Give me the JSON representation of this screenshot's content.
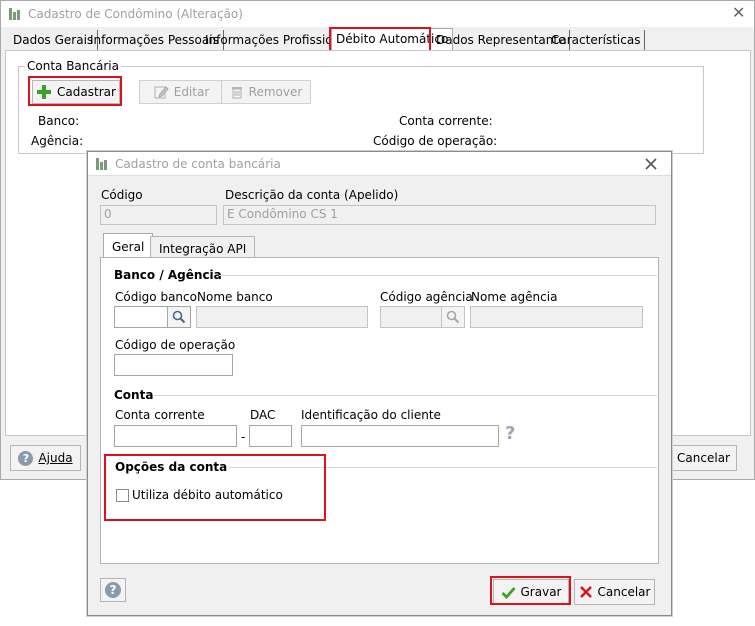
{
  "main_window": {
    "title": "Cadastro de Condômino (Alteração)",
    "tabs": [
      {
        "label": "Dados Gerais"
      },
      {
        "label": "Informações Pessoais"
      },
      {
        "label": "Informações Profissionais"
      },
      {
        "label": "Débito Automático"
      },
      {
        "label": "Dados Representante"
      },
      {
        "label": "Características"
      }
    ],
    "conta_bancaria": {
      "legend": "Conta Bancária",
      "cadastrar_label": "Cadastrar",
      "editar_label": "Editar",
      "remover_label": "Remover",
      "banco_label": "Banco:",
      "agencia_label": "Agência:",
      "conta_corrente_label": "Conta corrente:",
      "codigo_operacao_label": "Código de operação:"
    },
    "ajuda_label": "Ajuda",
    "ajuda_mnemonic": "A",
    "cancelar_label": "Cancelar"
  },
  "dialog": {
    "title": "Cadastro de conta bancária",
    "codigo_label": "Código",
    "codigo_value": "0",
    "descricao_label": "Descrição da conta (Apelido)",
    "descricao_value": "E Condômino CS 1",
    "tabs": [
      {
        "label": "Geral"
      },
      {
        "label": "Integração API"
      }
    ],
    "banco_agencia": {
      "title": "Banco / Agência",
      "codigo_banco_label": "Código banco",
      "codigo_banco_value": "",
      "nome_banco_label": "Nome banco",
      "nome_banco_value": "",
      "codigo_agencia_label": "Código agência",
      "codigo_agencia_value": "",
      "nome_agencia_label": "Nome agência",
      "nome_agencia_value": "",
      "codigo_operacao_label": "Código de operação",
      "codigo_operacao_value": ""
    },
    "conta": {
      "title": "Conta",
      "conta_corrente_label": "Conta corrente",
      "conta_corrente_value": "",
      "separator": "-",
      "dac_label": "DAC",
      "dac_value": "",
      "identificacao_label": "Identificação do cliente",
      "identificacao_value": "",
      "help_glyph": "?"
    },
    "opcoes": {
      "title": "Opções da conta",
      "debito_automatico_label": "Utiliza débito automático",
      "debito_automatico_checked": false
    },
    "help_glyph": "?",
    "gravar_label": "Gravar",
    "cancelar_label": "Cancelar"
  },
  "colors": {
    "highlight": "#d9141e",
    "add_icon": "#3aa02a",
    "check_icon": "#3aa02a",
    "cancel_icon": "#d9141e"
  },
  "icons": {
    "app": "building-icon",
    "add": "plus-icon",
    "edit": "pencil-icon",
    "remove": "trash-icon",
    "search": "magnifier-icon",
    "help": "question-icon",
    "ok": "check-icon",
    "cancel": "x-icon"
  }
}
